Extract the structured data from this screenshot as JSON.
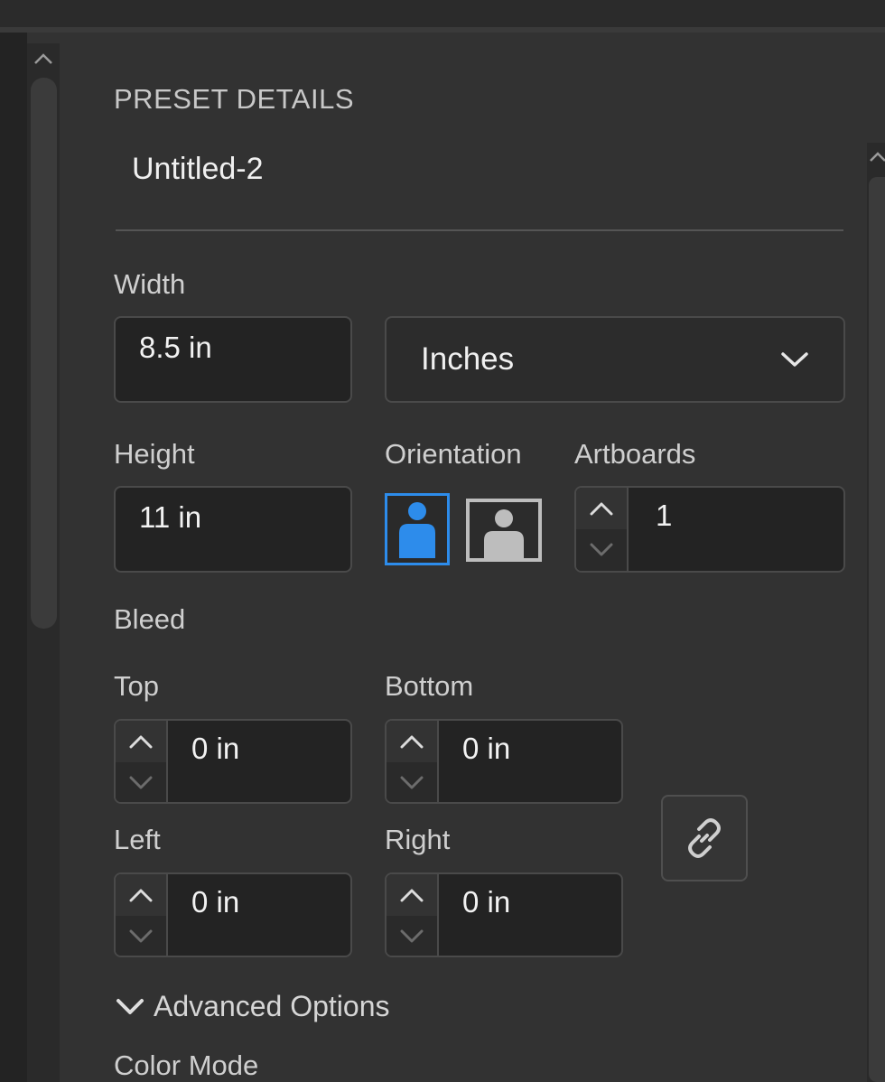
{
  "panel": {
    "section_title": "PRESET DETAILS",
    "preset_name": "Untitled-2"
  },
  "width": {
    "label": "Width",
    "value": "8.5 in"
  },
  "units": {
    "selected": "Inches"
  },
  "height": {
    "label": "Height",
    "value": "11 in"
  },
  "orientation": {
    "label": "Orientation",
    "selected": "portrait",
    "accent_color": "#2d8ceb"
  },
  "artboards": {
    "label": "Artboards",
    "value": "1"
  },
  "bleed": {
    "label": "Bleed",
    "top": {
      "label": "Top",
      "value": "0 in"
    },
    "bottom": {
      "label": "Bottom",
      "value": "0 in"
    },
    "left": {
      "label": "Left",
      "value": "0 in"
    },
    "right": {
      "label": "Right",
      "value": "0 in"
    }
  },
  "advanced": {
    "label": "Advanced Options"
  },
  "color_mode": {
    "label": "Color Mode"
  }
}
